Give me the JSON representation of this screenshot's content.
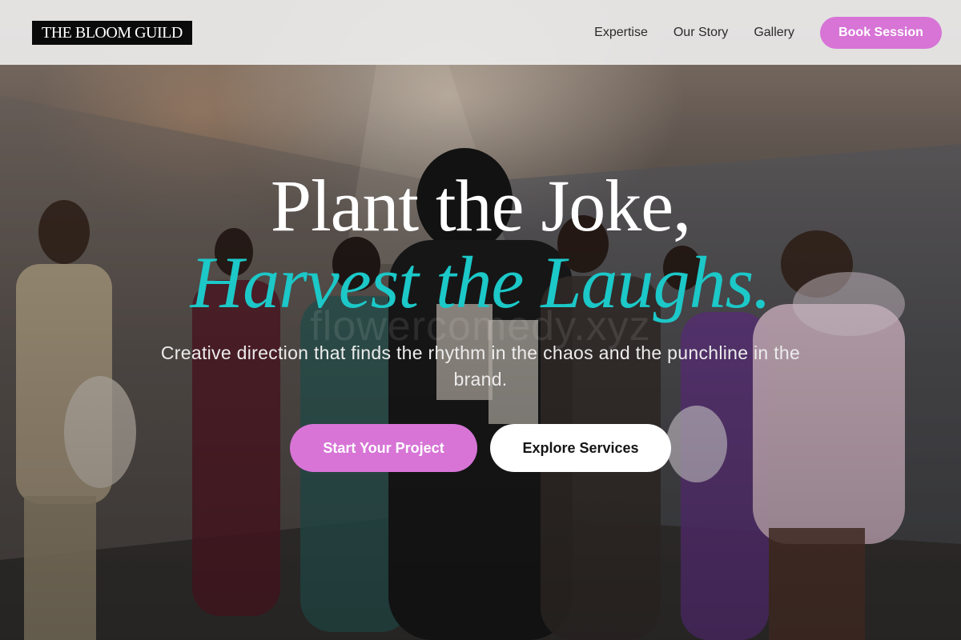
{
  "header": {
    "logo_text": "THE BLOOM GUILD",
    "nav": [
      {
        "label": "Expertise"
      },
      {
        "label": "Our Story"
      },
      {
        "label": "Gallery"
      }
    ],
    "cta_label": "Book Session"
  },
  "hero": {
    "headline_line1": "Plant the Joke,",
    "headline_line2": "Harvest the Laughs.",
    "watermark_text": "flowercomedy.xyz",
    "subtitle": "Creative direction that finds the rhythm in the chaos and the punchline in the brand.",
    "primary_cta": "Start Your Project",
    "secondary_cta": "Explore Services"
  },
  "colors": {
    "accent_pink": "#d774d6",
    "accent_teal": "#1cc8c8",
    "header_bg": "#ececec",
    "logo_bg": "#0a0a0a"
  }
}
